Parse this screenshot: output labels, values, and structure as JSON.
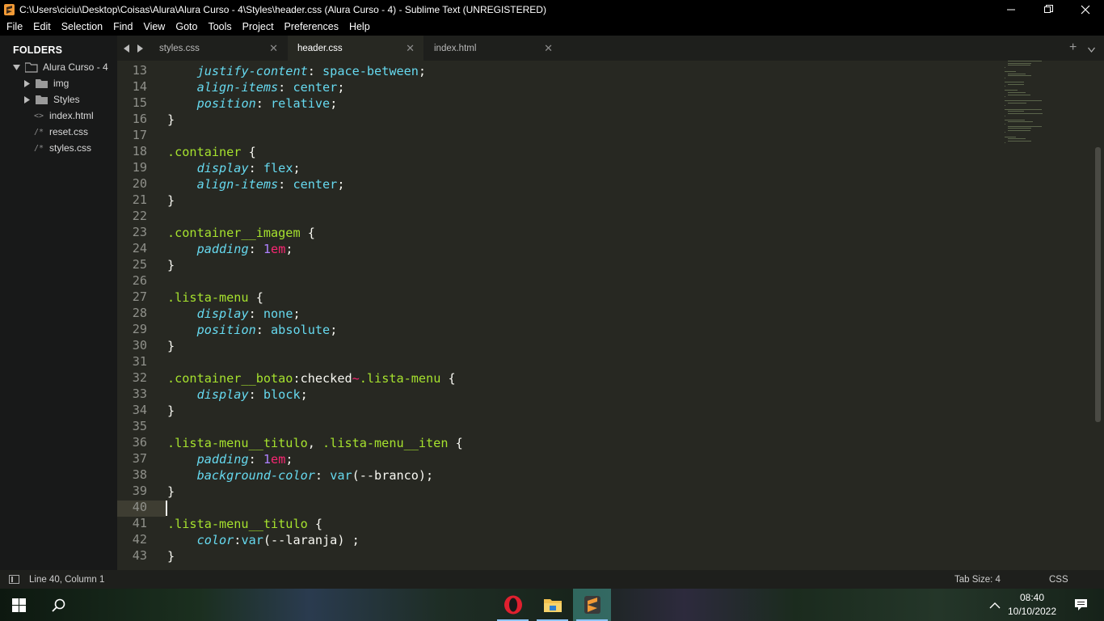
{
  "window": {
    "title": "C:\\Users\\ciciu\\Desktop\\Coisas\\Alura\\Alura Curso - 4\\Styles\\header.css (Alura Curso - 4) - Sublime Text (UNREGISTERED)"
  },
  "menu": [
    "File",
    "Edit",
    "Selection",
    "Find",
    "View",
    "Goto",
    "Tools",
    "Project",
    "Preferences",
    "Help"
  ],
  "sidebar": {
    "header": "FOLDERS",
    "root": "Alura Curso - 4",
    "items": [
      {
        "label": "img",
        "kind": "folder"
      },
      {
        "label": "Styles",
        "kind": "folder"
      },
      {
        "label": "index.html",
        "kind": "html"
      },
      {
        "label": "reset.css",
        "kind": "css"
      },
      {
        "label": "styles.css",
        "kind": "css"
      }
    ],
    "file_glyphs": {
      "html": "<>",
      "css": "/*"
    }
  },
  "tabs": [
    {
      "label": "styles.css",
      "active": false
    },
    {
      "label": "header.css",
      "active": true
    },
    {
      "label": "index.html",
      "active": false
    }
  ],
  "editor": {
    "active_line": 40,
    "lines": [
      {
        "n": "13",
        "tokens": [
          [
            "i",
            "    "
          ],
          [
            "prop",
            "justify-content"
          ],
          [
            "pl",
            ": "
          ],
          [
            "val",
            "space-between"
          ],
          [
            "pl",
            ";"
          ]
        ]
      },
      {
        "n": "14",
        "tokens": [
          [
            "i",
            "    "
          ],
          [
            "prop",
            "align-items"
          ],
          [
            "pl",
            ": "
          ],
          [
            "val",
            "center"
          ],
          [
            "pl",
            ";"
          ]
        ]
      },
      {
        "n": "15",
        "tokens": [
          [
            "i",
            "    "
          ],
          [
            "prop",
            "position"
          ],
          [
            "pl",
            ": "
          ],
          [
            "val",
            "relative"
          ],
          [
            "pl",
            ";"
          ]
        ]
      },
      {
        "n": "16",
        "tokens": [
          [
            "pl",
            "}"
          ]
        ]
      },
      {
        "n": "17",
        "tokens": []
      },
      {
        "n": "18",
        "tokens": [
          [
            "sel",
            ".container"
          ],
          [
            "pl",
            " {"
          ]
        ]
      },
      {
        "n": "19",
        "tokens": [
          [
            "i",
            "    "
          ],
          [
            "prop",
            "display"
          ],
          [
            "pl",
            ": "
          ],
          [
            "val",
            "flex"
          ],
          [
            "pl",
            ";"
          ]
        ]
      },
      {
        "n": "20",
        "tokens": [
          [
            "i",
            "    "
          ],
          [
            "prop",
            "align-items"
          ],
          [
            "pl",
            ": "
          ],
          [
            "val",
            "center"
          ],
          [
            "pl",
            ";"
          ]
        ]
      },
      {
        "n": "21",
        "tokens": [
          [
            "pl",
            "}"
          ]
        ]
      },
      {
        "n": "22",
        "tokens": []
      },
      {
        "n": "23",
        "tokens": [
          [
            "sel",
            ".container__imagem"
          ],
          [
            "pl",
            " {"
          ]
        ]
      },
      {
        "n": "24",
        "tokens": [
          [
            "i",
            "    "
          ],
          [
            "prop",
            "padding"
          ],
          [
            "pl",
            ": "
          ],
          [
            "num",
            "1"
          ],
          [
            "kw",
            "em"
          ],
          [
            "pl",
            ";"
          ]
        ]
      },
      {
        "n": "25",
        "tokens": [
          [
            "pl",
            "}"
          ]
        ]
      },
      {
        "n": "26",
        "tokens": []
      },
      {
        "n": "27",
        "tokens": [
          [
            "sel",
            ".lista-menu"
          ],
          [
            "pl",
            " {"
          ]
        ]
      },
      {
        "n": "28",
        "tokens": [
          [
            "i",
            "    "
          ],
          [
            "prop",
            "display"
          ],
          [
            "pl",
            ": "
          ],
          [
            "val",
            "none"
          ],
          [
            "pl",
            ";"
          ]
        ]
      },
      {
        "n": "29",
        "tokens": [
          [
            "i",
            "    "
          ],
          [
            "prop",
            "position"
          ],
          [
            "pl",
            ": "
          ],
          [
            "val",
            "absolute"
          ],
          [
            "pl",
            ";"
          ]
        ]
      },
      {
        "n": "30",
        "tokens": [
          [
            "pl",
            "}"
          ]
        ]
      },
      {
        "n": "31",
        "tokens": []
      },
      {
        "n": "32",
        "tokens": [
          [
            "sel",
            ".container__botao"
          ],
          [
            "pl",
            ":checked"
          ],
          [
            "kw",
            "~"
          ],
          [
            "sel",
            ".lista-menu"
          ],
          [
            "pl",
            " {"
          ]
        ]
      },
      {
        "n": "33",
        "tokens": [
          [
            "i",
            "    "
          ],
          [
            "prop",
            "display"
          ],
          [
            "pl",
            ": "
          ],
          [
            "val",
            "block"
          ],
          [
            "pl",
            ";"
          ]
        ]
      },
      {
        "n": "34",
        "tokens": [
          [
            "pl",
            "}"
          ]
        ]
      },
      {
        "n": "35",
        "tokens": []
      },
      {
        "n": "36",
        "tokens": [
          [
            "sel",
            ".lista-menu__titulo"
          ],
          [
            "pl",
            ", "
          ],
          [
            "sel",
            ".lista-menu__iten"
          ],
          [
            "pl",
            " {"
          ]
        ]
      },
      {
        "n": "37",
        "tokens": [
          [
            "i",
            "    "
          ],
          [
            "prop",
            "padding"
          ],
          [
            "pl",
            ": "
          ],
          [
            "num",
            "1"
          ],
          [
            "kw",
            "em"
          ],
          [
            "pl",
            ";"
          ]
        ]
      },
      {
        "n": "38",
        "tokens": [
          [
            "i",
            "    "
          ],
          [
            "prop",
            "background-color"
          ],
          [
            "pl",
            ": "
          ],
          [
            "val",
            "var"
          ],
          [
            "pl",
            "(--branco);"
          ]
        ]
      },
      {
        "n": "39",
        "tokens": [
          [
            "pl",
            "}"
          ]
        ]
      },
      {
        "n": "40",
        "tokens": []
      },
      {
        "n": "41",
        "tokens": [
          [
            "sel",
            ".lista-menu__titulo"
          ],
          [
            "pl",
            " {"
          ]
        ]
      },
      {
        "n": "42",
        "tokens": [
          [
            "i",
            "    "
          ],
          [
            "prop",
            "color"
          ],
          [
            "pl",
            ":"
          ],
          [
            "val",
            "var"
          ],
          [
            "pl",
            "(--laranja) ;"
          ]
        ]
      },
      {
        "n": "43",
        "tokens": [
          [
            "pl",
            "}"
          ]
        ]
      }
    ]
  },
  "status": {
    "position": "Line 40, Column 1",
    "tab_size": "Tab Size: 4",
    "syntax": "CSS"
  },
  "taskbar": {
    "time": "08:40",
    "date": "10/10/2022",
    "apps": [
      "opera-icon",
      "file-explorer-icon",
      "sublime-text-icon"
    ]
  },
  "colors": {
    "background": "#272822",
    "selector": "#a6e22e",
    "property": "#66d9ef",
    "number": "#ae81ff",
    "keyword": "#f92672",
    "plain": "#f8f8f2"
  }
}
